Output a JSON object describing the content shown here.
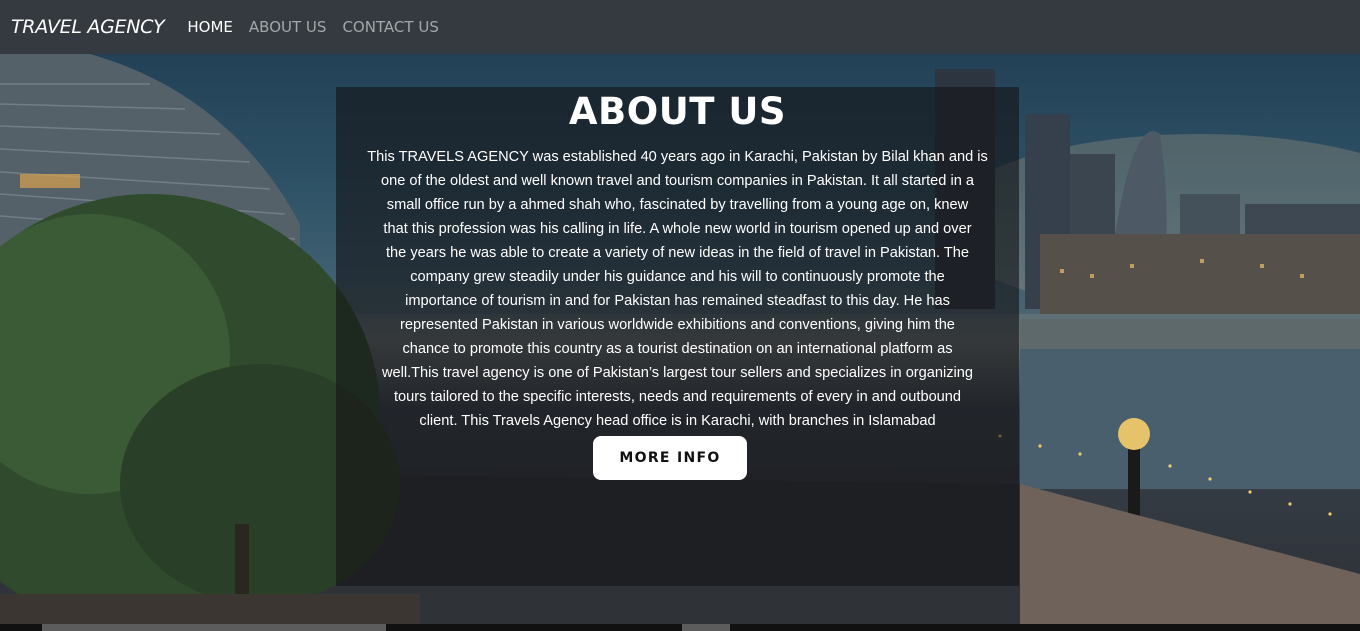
{
  "navbar": {
    "brand": "TRAVEL AGENCY",
    "items": [
      {
        "label": "HOME",
        "active": true
      },
      {
        "label": "ABOUT US",
        "active": false
      },
      {
        "label": "CONTACT US",
        "active": false
      }
    ]
  },
  "about": {
    "title": "ABOUT US",
    "lines": [
      "This TRAVELS AGENCY was established 40 years ago in Karachi, Pakistan by Bilal khan and is",
      "one of the oldest and well known travel and tourism companies in Pakistan. It all started in a",
      "small office run by a ahmed shah who, fascinated by travelling from a young age on, knew",
      "that this profession was his calling in life. A whole new world in tourism opened up and over",
      "the years he was able to create a variety of new ideas in the field of travel in Pakistan. The",
      "company grew steadily under his guidance and his will to continuously promote the",
      "importance of tourism in and for Pakistan has remained steadfast to this day. He has",
      "represented Pakistan in various worldwide exhibitions and conventions, giving him the",
      "chance to promote this country as a tourist destination on an international platform as",
      "well.This travel agency is one of Pakistan’s largest tour sellers and specializes in organizing",
      "tours tailored to the specific interests, needs and requirements of every in and outbound",
      "client. This Travels Agency head office is in Karachi, with branches in Islamabad"
    ],
    "button_label": "MORE INFO"
  },
  "colors": {
    "navbar_bg": "#343a40",
    "overlay": "rgba(20,20,22,0.62)",
    "button_bg": "#ffffff"
  }
}
